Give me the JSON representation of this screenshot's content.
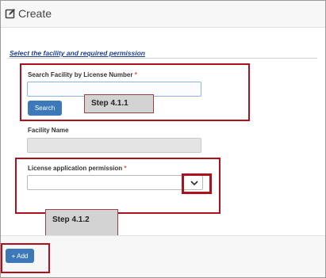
{
  "header": {
    "title": "Create"
  },
  "section": {
    "link_text": "Select the facility and required permission"
  },
  "search": {
    "label": "Search Facility by License Number",
    "required_mark": "*",
    "value": "",
    "button_label": "Search"
  },
  "facility": {
    "label": "Facility Name",
    "value": ""
  },
  "permission": {
    "label": "License application permission",
    "required_mark": "*",
    "selected": ""
  },
  "steps": {
    "step1": "Step 4.1.1",
    "step2": "Step 4.1.2"
  },
  "footer": {
    "add_label": "+ Add"
  },
  "colors": {
    "accent": "#3d79b8",
    "callout": "#b0101e",
    "link": "#1d3f8f"
  }
}
